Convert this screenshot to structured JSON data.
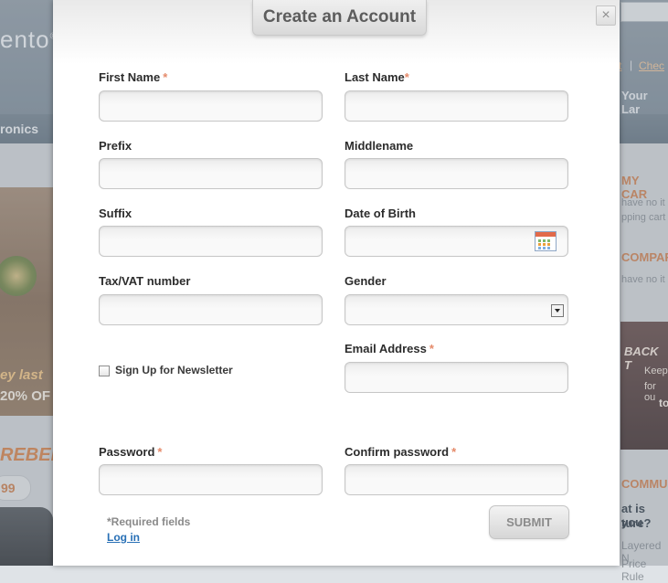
{
  "background": {
    "logo": "ento",
    "logo_mark": "®",
    "nav": "ronics",
    "header_links": [
      "t",
      "Chec"
    ],
    "language": "Your Lar",
    "banner_text_1": "ey last",
    "banner_text_2": "20% OF",
    "rebel_text": "REBEL",
    "price": "99",
    "cart_title": "MY CAR",
    "cart_text_1": "have no it",
    "cart_text_2": "pping cart",
    "compare_title": "COMPAR",
    "compare_text": "have no it",
    "promo_title": "BACK T",
    "promo_line_1": "Keep",
    "promo_line_2": "for ou",
    "promo_line_3": "to",
    "community_title": "COMMU",
    "poll_q1": "at is you",
    "poll_q2": "ture?",
    "layered": "Layered N",
    "price_rule": "Price Rule"
  },
  "modal": {
    "title": "Create an Account",
    "close": "×",
    "required_marker": "*",
    "fields": {
      "first_name": "First Name",
      "last_name": "Last Name",
      "prefix": "Prefix",
      "middlename": "Middlename",
      "suffix": "Suffix",
      "dob": "Date of Birth",
      "taxvat": "Tax/VAT number",
      "gender": "Gender",
      "email": "Email Address",
      "password": "Password",
      "confirm_password": "Confirm password"
    },
    "newsletter": "Sign Up for Newsletter",
    "required_note": "*Required fields",
    "login_link": "Log in",
    "submit": "SUBMIT"
  }
}
